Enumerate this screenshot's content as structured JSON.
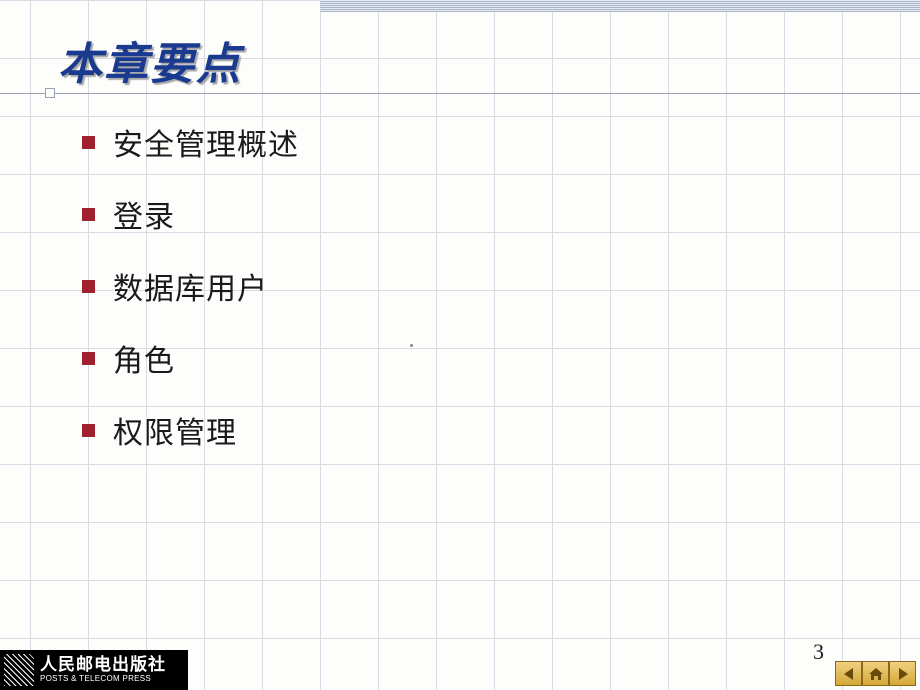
{
  "title": "本章要点",
  "bullets": [
    "安全管理概述",
    "登录",
    "数据库用户",
    "角色",
    "权限管理"
  ],
  "page_number": "3",
  "publisher": {
    "cn": "人民邮电出版社",
    "en": "POSTS & TELECOM PRESS"
  },
  "nav": {
    "prev_icon": "triangle-left-icon",
    "home_icon": "home-icon",
    "next_icon": "triangle-right-icon"
  },
  "colors": {
    "title": "#1a3a8f",
    "bullet": "#a02030",
    "grid": "#d8dae4",
    "nav_button": "#d4a838"
  }
}
